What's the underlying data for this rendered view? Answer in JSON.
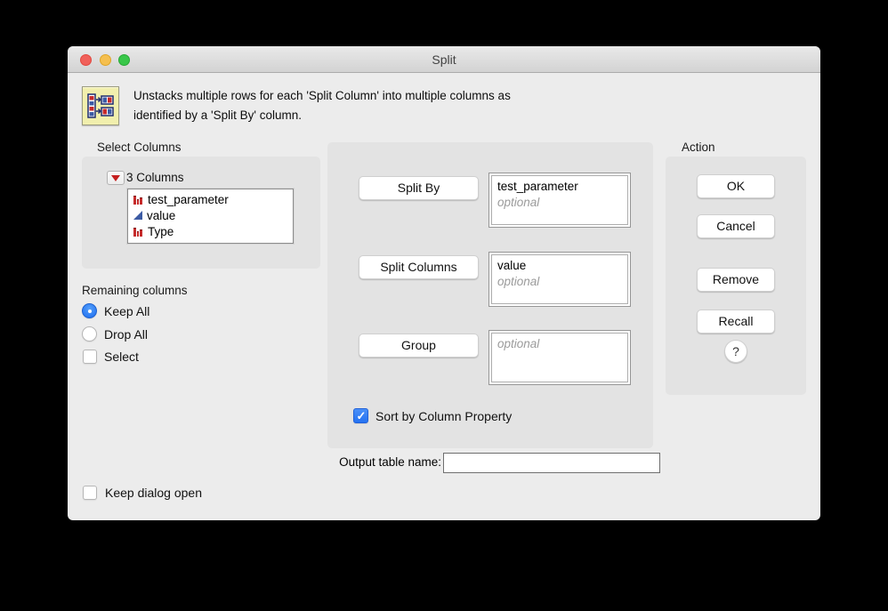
{
  "window": {
    "title": "Split"
  },
  "titlebar_buttons": {
    "close": "close",
    "minimize": "minimize",
    "zoom": "zoom"
  },
  "header": {
    "icon": "split-table-icon",
    "description_line1": "Unstacks multiple rows for each 'Split Column' into multiple columns as",
    "description_line2": "identified by a 'Split By' column."
  },
  "select_columns": {
    "label": "Select Columns",
    "count_label": "3 Columns",
    "columns": [
      {
        "name": "test_parameter",
        "type_icon": "nominal-icon"
      },
      {
        "name": "value",
        "type_icon": "continuous-icon"
      },
      {
        "name": "Type",
        "type_icon": "nominal-icon"
      }
    ]
  },
  "remaining_columns": {
    "label": "Remaining columns",
    "options": [
      {
        "label": "Keep All",
        "control": "radio",
        "selected": true
      },
      {
        "label": "Drop All",
        "control": "radio",
        "selected": false
      },
      {
        "label": "Select",
        "control": "checkbox",
        "checked": false
      }
    ]
  },
  "cast_roles": [
    {
      "button": "Split By",
      "value": "test_parameter",
      "placeholder": "optional"
    },
    {
      "button": "Split Columns",
      "value": "value",
      "placeholder": "optional"
    },
    {
      "button": "Group",
      "value": "",
      "placeholder": "optional"
    }
  ],
  "sort_checkbox": {
    "label": "Sort by Column Property",
    "checked": true
  },
  "output": {
    "label": "Output table name:",
    "value": ""
  },
  "action": {
    "label": "Action",
    "buttons": [
      "OK",
      "Cancel",
      "Remove",
      "Recall"
    ],
    "help_label": "?"
  },
  "footer": {
    "keep_dialog_open_label": "Keep dialog open",
    "checked": false
  },
  "colors": {
    "accent_blue": "#2e7cf6",
    "window_bg": "#ececec",
    "panel_bg": "#e3e3e3",
    "traffic_red": "#f0605a",
    "traffic_yellow": "#f5bf4f",
    "traffic_green": "#39c74a",
    "nominal_red": "#c62b2b",
    "continuous_blue": "#3c5ba4"
  }
}
